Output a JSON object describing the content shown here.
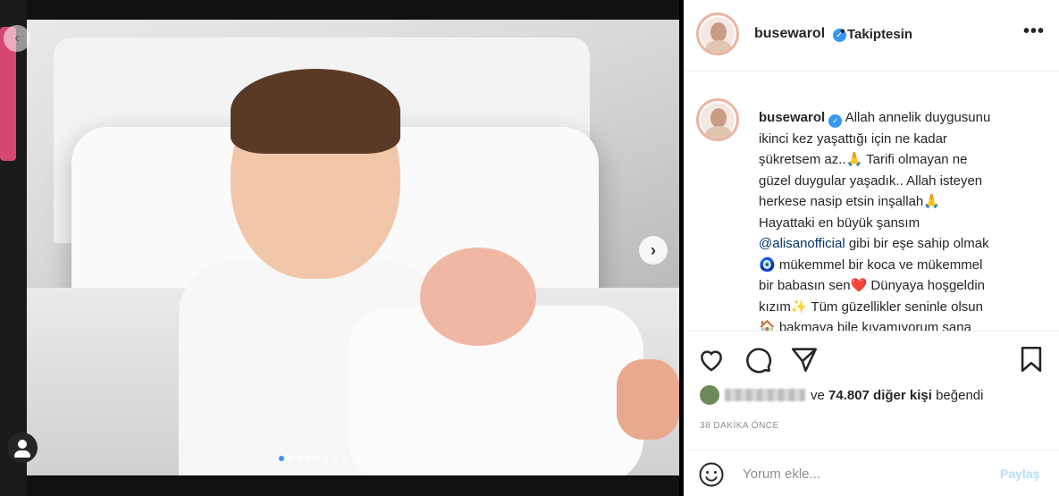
{
  "post": {
    "username": "busewarol",
    "follow_status": "Takiptesin",
    "more_icon": "more-horizontal-icon",
    "verified_icon": "verified-badge-icon"
  },
  "caption": {
    "username": "busewarol",
    "lines": [
      "Allah annelik duygusunu",
      "ikinci kez yaşattığı için ne kadar",
      "şükretsem az..🙏 Tarifi olmayan ne",
      "güzel duygular yaşadık.. Allah isteyen",
      "herkese nasip etsin inşallah🙏",
      "Hayattaki en büyük şansım",
      "gibi bir eşe sahip olmak",
      "🧿 mükemmel bir koca ve mükemmel",
      "bir babasın sen❤️ Dünyaya hoşgeldin",
      "kızım✨ Tüm güzellikler seninle olsun",
      "🏠 bakmaya bile kıyamıyorum sana"
    ],
    "mention": "@alisanofficial"
  },
  "actions": {
    "like_icon": "heart-icon",
    "comment_icon": "comment-icon",
    "share_icon": "send-icon",
    "save_icon": "bookmark-icon"
  },
  "likes": {
    "prefix": "ve",
    "count_text": "74.807 diğer kişi",
    "suffix": "beğendi"
  },
  "timestamp": "38 DAKİKA ÖNCE",
  "comment": {
    "placeholder": "Yorum ekle...",
    "submit_label": "Paylaş",
    "emoji_icon": "smile-icon"
  },
  "media": {
    "next_icon": "chevron-right-icon",
    "prev_icon": "chevron-left-icon",
    "tag_icon": "user-tag-icon",
    "carousel_count": 8,
    "carousel_active": 1
  },
  "colors": {
    "accent": "#3897f0",
    "link": "#00376b",
    "muted": "#8e8e8e",
    "submit_disabled": "#b3dbff"
  }
}
